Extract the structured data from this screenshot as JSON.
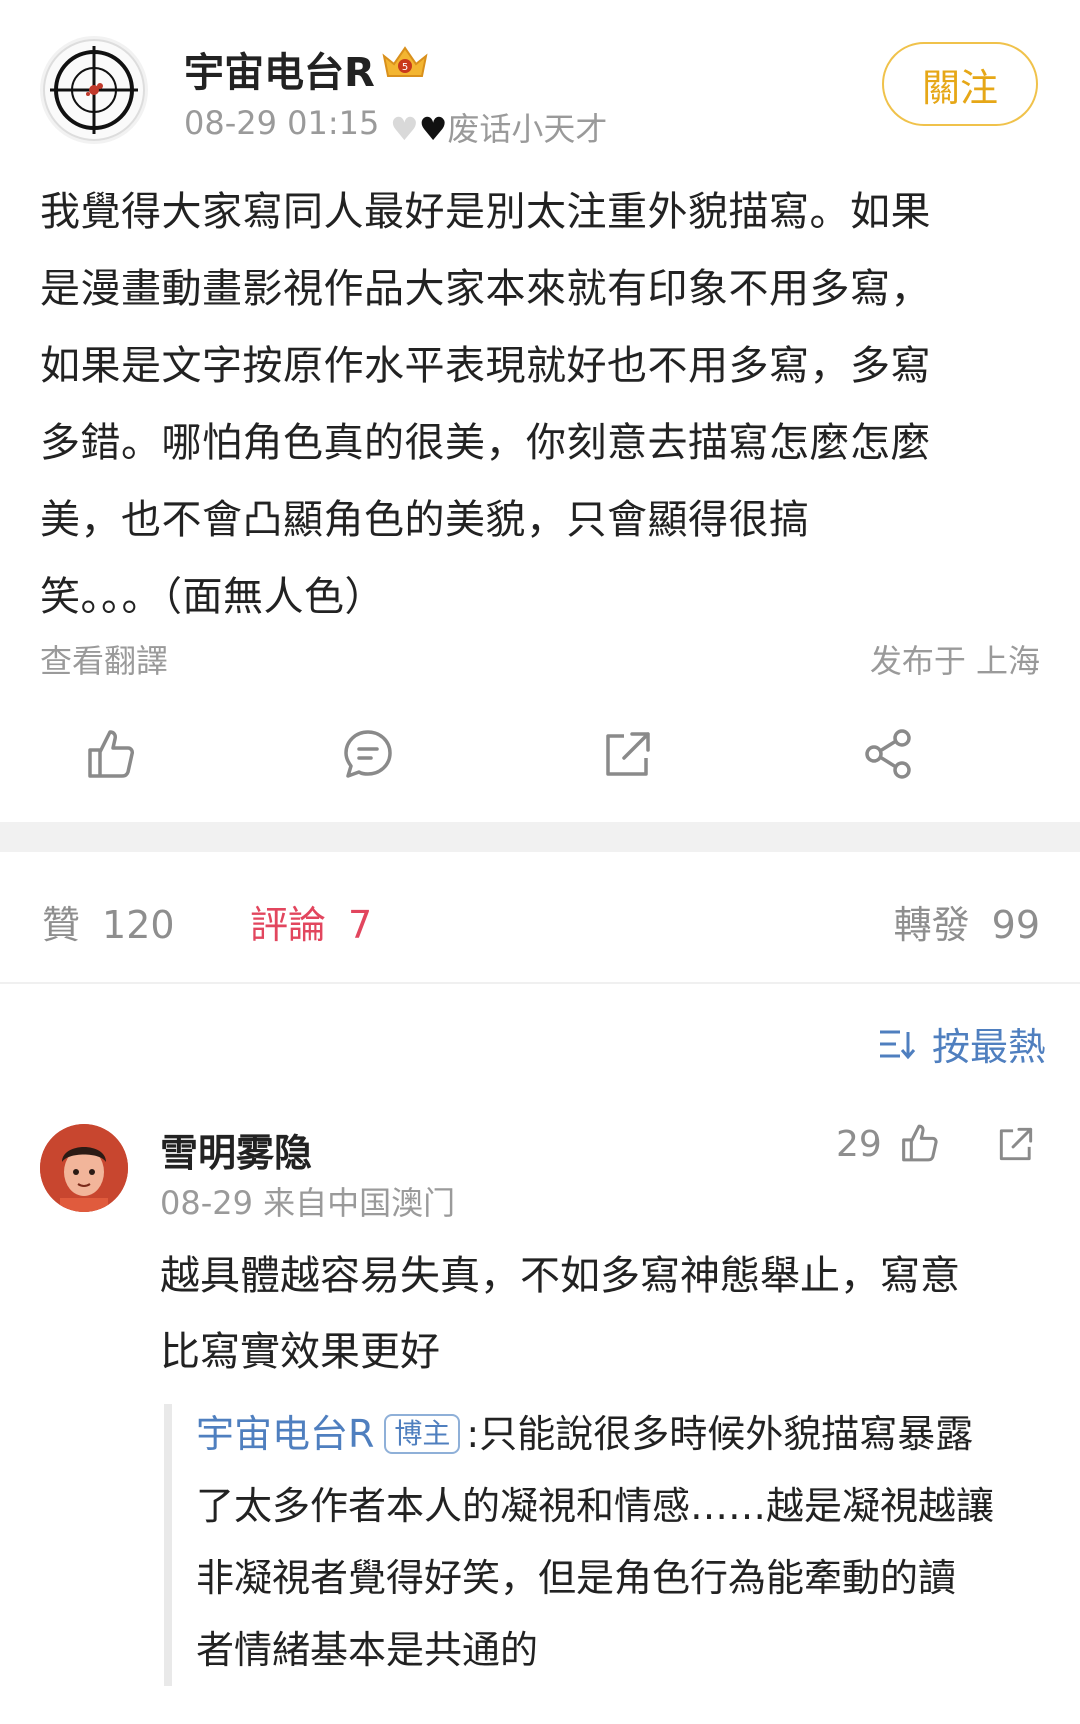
{
  "post": {
    "author": "宇宙电台R",
    "time": "08-29 01:15",
    "tail": "废话小天才",
    "follow_label": "關注",
    "body_lines": [
      "我覺得大家寫同人最好是別太注重外貌描寫。如果",
      "是漫畫動畫影視作品大家本來就有印象不用多寫，",
      "如果是文字按原作水平表現就好也不用多寫，多寫",
      "多錯。哪怕角色真的很美，你刻意去描寫怎麼怎麼",
      "美，也不會凸顯角色的美貌，只會顯得很搞",
      "笑。。。（面無人色）"
    ],
    "view_translation": "查看翻譯",
    "location": "发布于 上海"
  },
  "actions": {
    "like": "like-icon",
    "comment": "comment-icon",
    "repost": "repost-icon",
    "share": "share-icon"
  },
  "stats": {
    "likes_label": "贊",
    "likes_count": "120",
    "comments_label": "評論",
    "comments_count": "7",
    "reposts_label": "轉發",
    "reposts_count": "99"
  },
  "sort": {
    "label": "按最熱"
  },
  "comment": {
    "user": "雪明雾隐",
    "meta": "08-29  来自中国澳门",
    "likes": "29",
    "body_lines": [
      "越具體越容易失真，不如多寫神態舉止，寫意",
      "比寫實效果更好"
    ],
    "reply": {
      "user": "宇宙电台R",
      "badge": "博主",
      "colon": ":",
      "text_first": "只能說很多時候外貌描寫暴露",
      "text_rest": [
        "了太多作者本人的凝視和情感……越是凝視越讓",
        "非凝視者覺得好笑，但是角色行為能牽動的讀",
        "者情緒基本是共通的"
      ]
    }
  },
  "colors": {
    "accent_follow": "#e6a717",
    "accent_link": "#4f7fbf",
    "active_tab": "#e2465e"
  }
}
